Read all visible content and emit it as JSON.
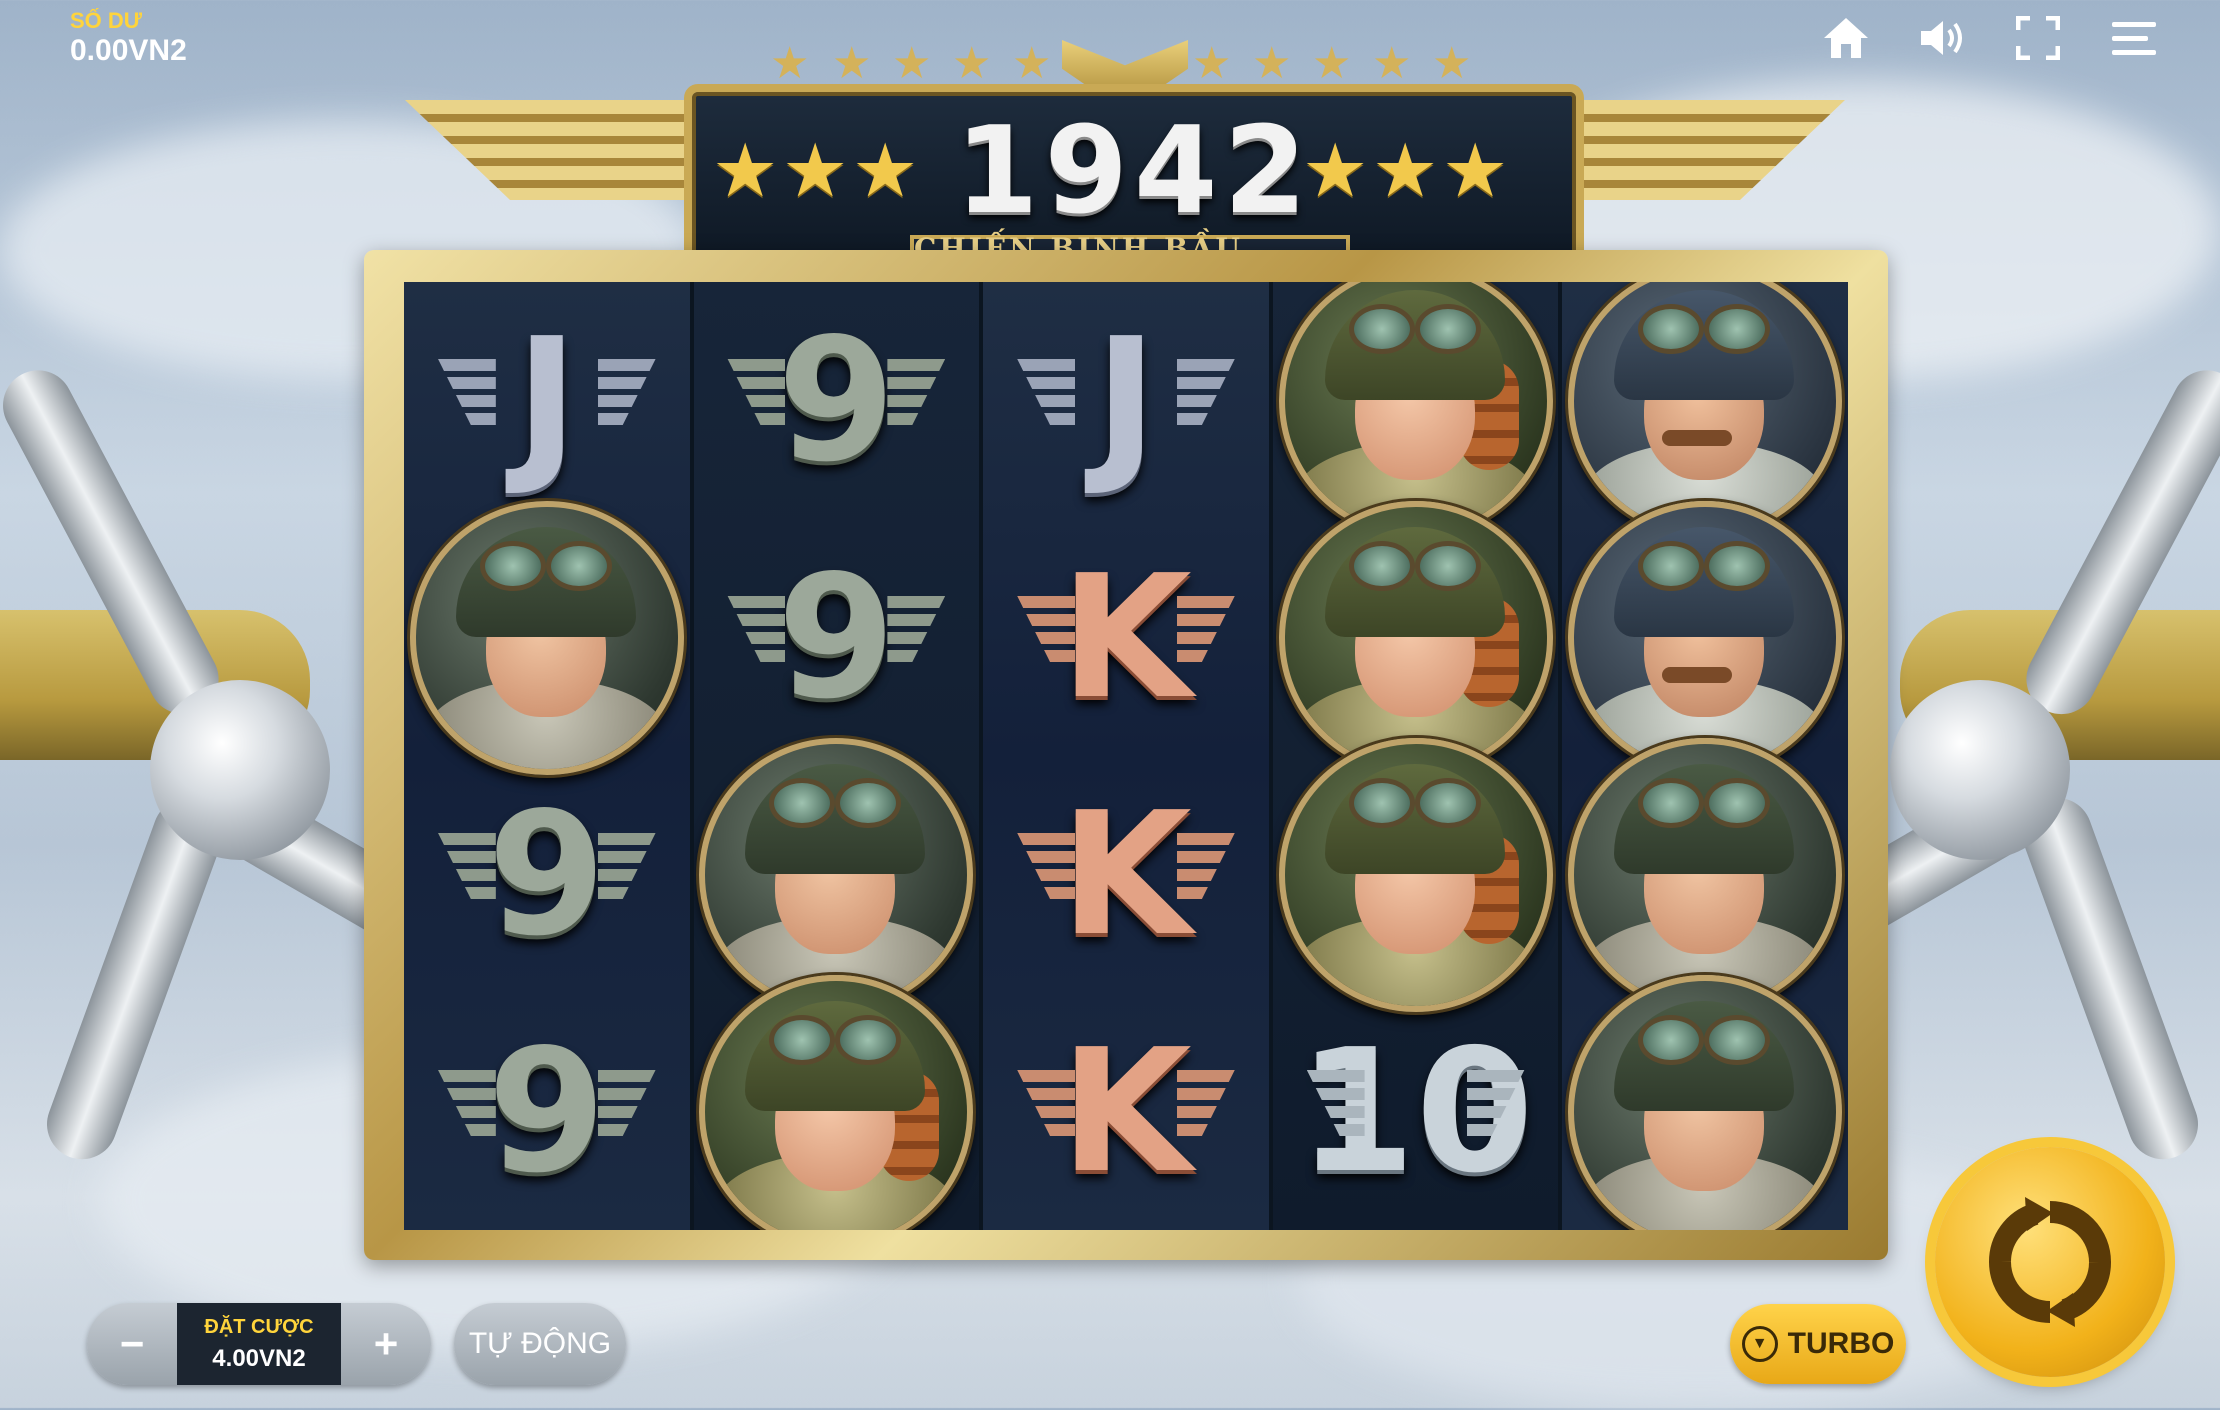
{
  "header": {
    "balance_label": "SỐ DƯ",
    "balance_value": "0.00VN2",
    "icons": [
      "home-icon",
      "sound-icon",
      "fullscreen-icon",
      "menu-icon"
    ]
  },
  "title": {
    "main": "1942",
    "subtitle": "CHIẾN BINH BẦU TRỜI"
  },
  "reels": [
    {
      "symbols": [
        "J",
        "pilot",
        "9",
        "9"
      ]
    },
    {
      "symbols": [
        "9",
        "9",
        "pilot",
        "woman"
      ]
    },
    {
      "symbols": [
        "J",
        "K",
        "K",
        "K"
      ]
    },
    {
      "symbols": [
        "woman",
        "woman",
        "woman",
        "10"
      ]
    },
    {
      "symbols": [
        "captain",
        "captain",
        "pilot",
        "pilot"
      ]
    }
  ],
  "controls": {
    "bet_label": "ĐẶT CƯỢC",
    "bet_value": "4.00VN2",
    "minus": "−",
    "plus": "+",
    "auto_label": "TỰ ĐỘNG",
    "turbo_label": "TURBO"
  },
  "colors": {
    "accent_gold": "#f2b21a",
    "balance_label": "#ffd43b",
    "frame_gold": "#c9a955"
  }
}
